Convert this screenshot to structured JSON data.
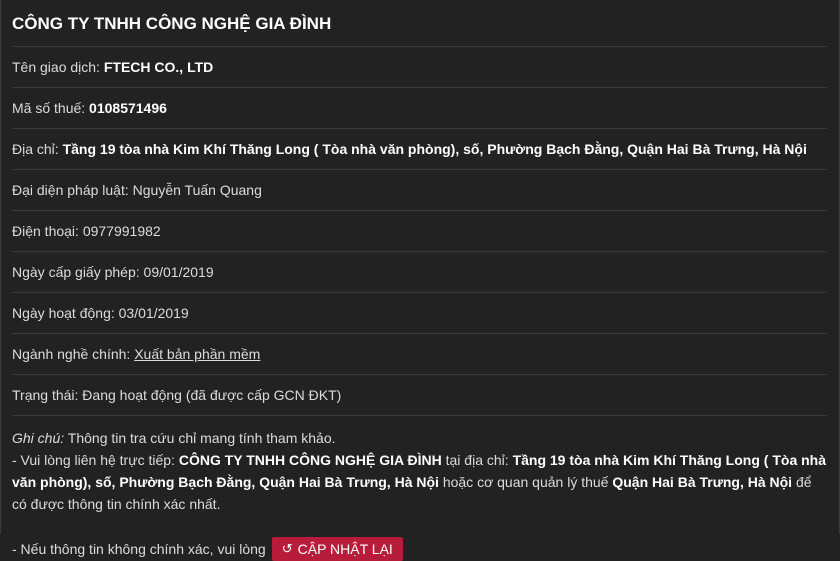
{
  "company": {
    "title": "CÔNG TY TNHH CÔNG NGHỆ GIA ĐÌNH",
    "trade_name_label": "Tên giao dịch:",
    "trade_name": "FTECH CO., LTD",
    "tax_code_label": "Mã số thuế:",
    "tax_code": "0108571496",
    "address_label": "Địa chỉ:",
    "address": "Tầng 19 tòa nhà Kim Khí Thăng Long ( Tòa nhà văn phòng), số, Phường Bạch Đằng, Quận Hai Bà Trưng, Hà Nội",
    "rep_label": "Đại diện pháp luật:",
    "rep": "Nguyễn Tuấn Quang",
    "phone_label": "Điện thoại:",
    "phone": "0977991982",
    "license_date_label": "Ngày cấp giấy phép:",
    "license_date": "09/01/2019",
    "active_date_label": "Ngày hoạt động:",
    "active_date": "03/01/2019",
    "industry_label": "Ngành nghề chính:",
    "industry": "Xuất bản phần mềm",
    "status_label": "Trạng thái:",
    "status": "Đang hoạt động (đã được cấp GCN ĐKT)"
  },
  "note": {
    "label": "Ghi chú:",
    "text1": "Thông tin tra cứu chỉ mang tính tham khảo.",
    "contact_prefix": "- Vui lòng liên hệ trực tiếp:",
    "contact_company": "CÔNG TY TNHH CÔNG NGHỆ GIA ĐÌNH",
    "contact_mid": "tại địa chỉ:",
    "contact_address": "Tầng 19 tòa nhà Kim Khí Thăng Long ( Tòa nhà văn phòng), số, Phường Bạch Đằng, Quận Hai Bà Trưng, Hà Nội",
    "contact_or": "hoặc cơ quan quản lý thuế",
    "tax_office": "Quận Hai Bà Trưng, Hà Nội",
    "contact_suffix": "để có được thông tin chính xác nhất.",
    "update_text": "- Nếu thông tin không chính xác, vui lòng",
    "update_button": "CẬP NHẬT LẠI",
    "update_icon": "↺"
  },
  "colors": {
    "background": "#222222",
    "button": "#b71c3a",
    "text": "#dcdcdc"
  }
}
